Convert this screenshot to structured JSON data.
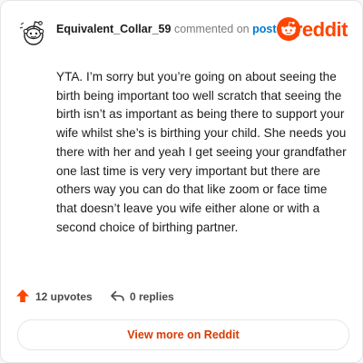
{
  "comment": {
    "username": "Equivalent_Collar_59",
    "action_text": "commented on",
    "target_text": "post",
    "body": "YTA. I’m sorry but you’re going on about seeing the birth being important too well scratch that seeing the birth isn’t as important as being there to support your wife whilst she’s is birthing your child. She needs you there with her and yeah I get seeing your grandfather one last time is very very important but there are others way you can do that like zoom or face time that doesn’t leave you wife either alone or with a second choice of birthing partner."
  },
  "brand": {
    "wordmark": "reddit",
    "color": "#ff4500"
  },
  "stats": {
    "upvotes_label": "12 upvotes",
    "replies_label": "0 replies",
    "upvote_icon": "upvote-arrow-icon",
    "reply_icon": "reply-arrow-icon"
  },
  "footer": {
    "view_more_label": "View more on Reddit"
  },
  "colors": {
    "accent": "#ff4500",
    "link": "#0079d3",
    "view_more_text": "#d93a00"
  }
}
